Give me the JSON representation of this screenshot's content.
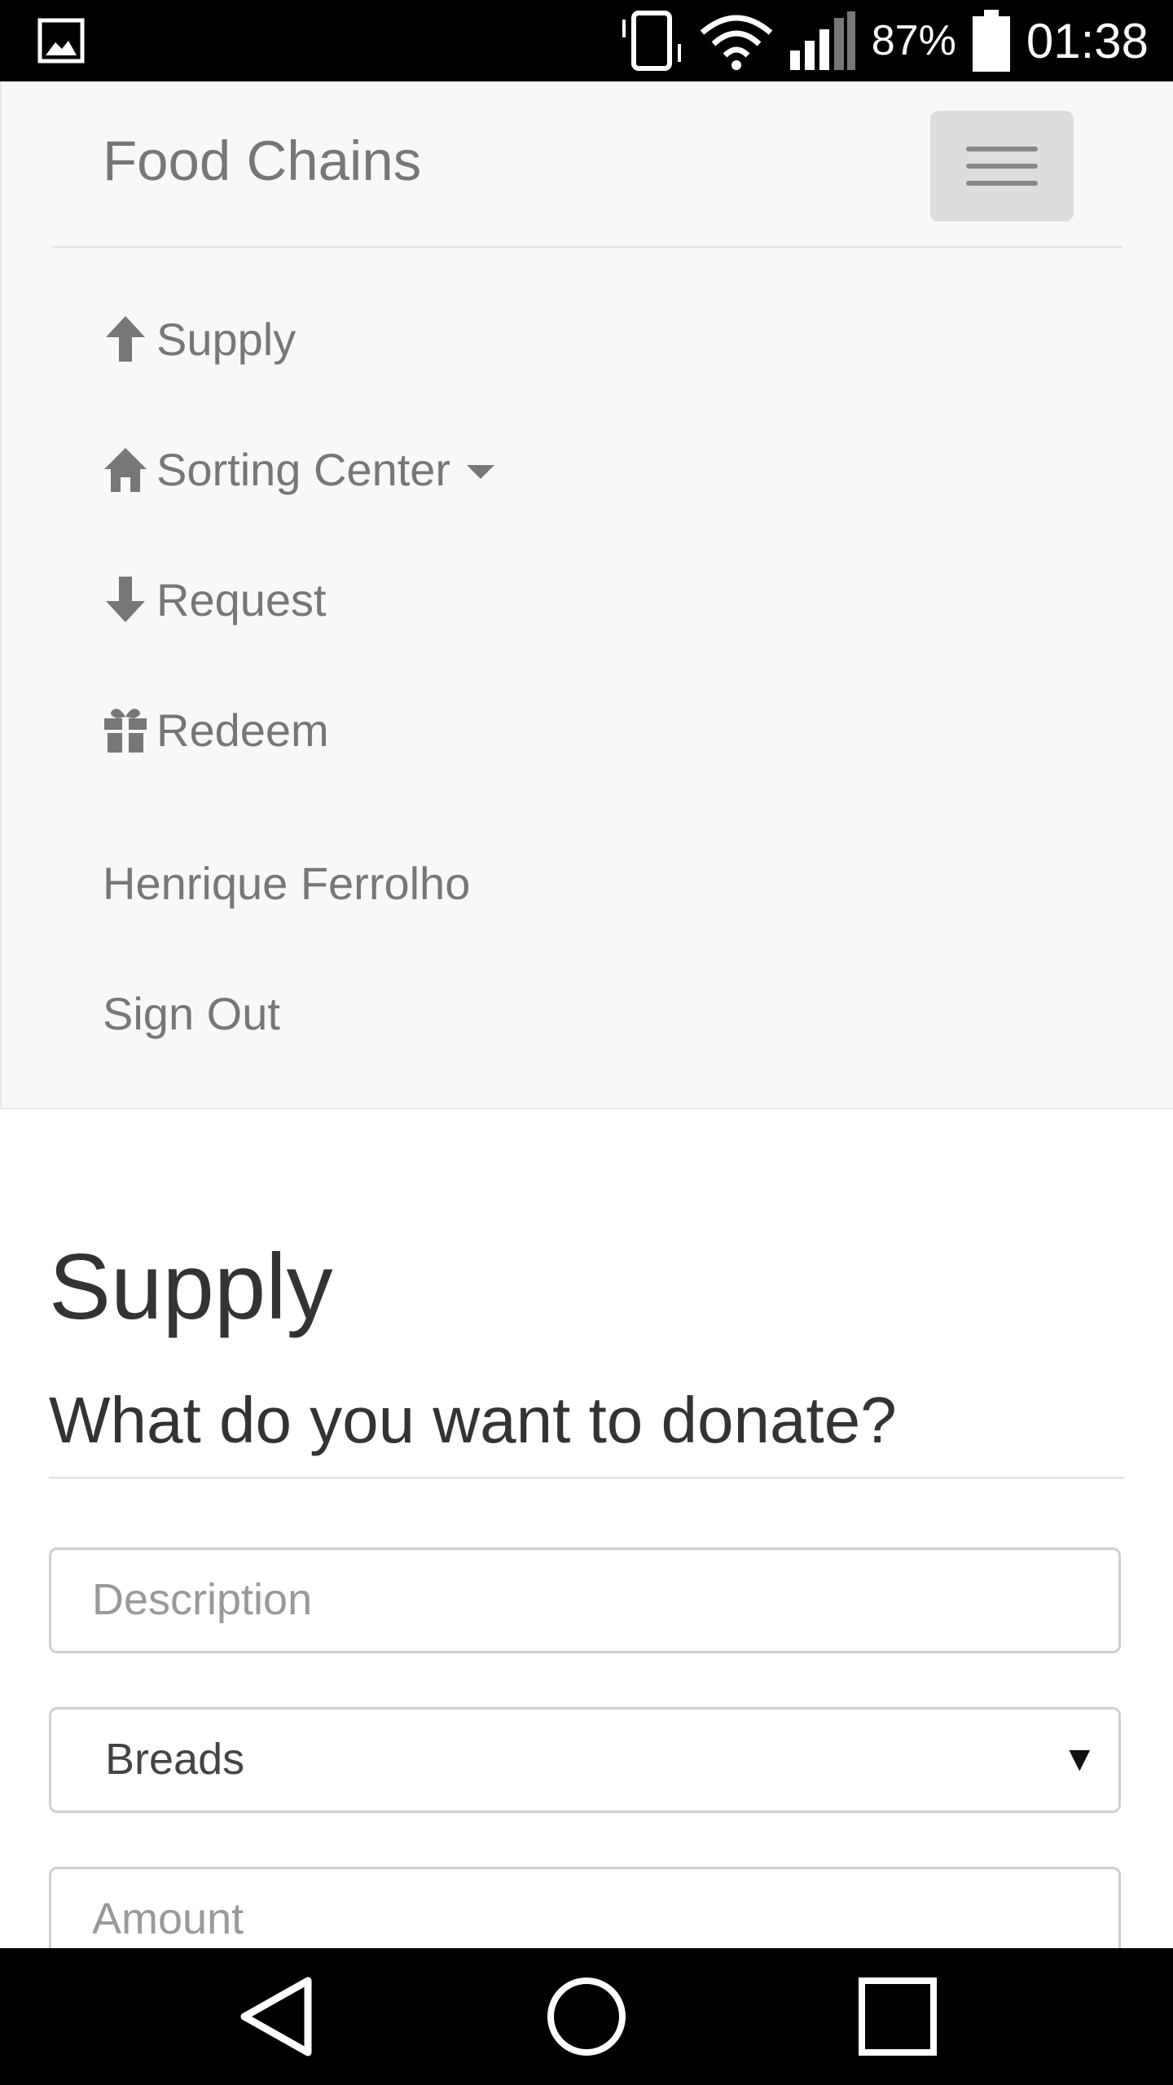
{
  "status_bar": {
    "battery_percent": "87%",
    "time": "01:38"
  },
  "navbar": {
    "brand": "Food Chains",
    "items": [
      {
        "label": "Supply",
        "icon": "arrow-up-icon"
      },
      {
        "label": "Sorting Center",
        "icon": "home-icon",
        "dropdown": true
      },
      {
        "label": "Request",
        "icon": "arrow-down-icon"
      },
      {
        "label": "Redeem",
        "icon": "gift-icon"
      }
    ],
    "user_name": "Henrique Ferrolho",
    "sign_out": "Sign Out"
  },
  "page": {
    "title": "Supply",
    "subtitle": "What do you want to donate?"
  },
  "form": {
    "description_placeholder": "Description",
    "category_selected": "Breads",
    "amount_placeholder": "Amount"
  },
  "colors": {
    "nav_text": "#777777",
    "nav_bg": "#f8f8f8",
    "heading": "#333333"
  }
}
